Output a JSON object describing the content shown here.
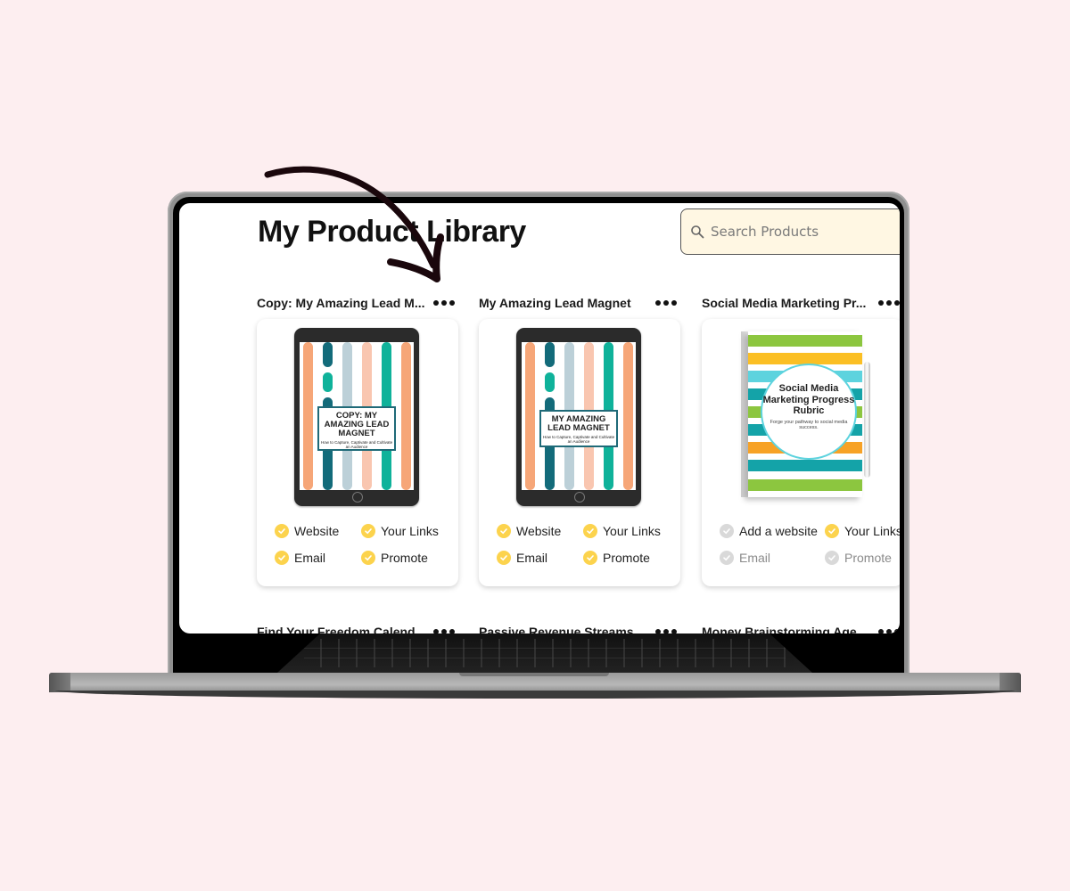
{
  "page": {
    "title": "My Product Library",
    "search": {
      "placeholder": "Search Products",
      "value": "",
      "icon": "search-icon"
    }
  },
  "colors": {
    "background": "#fdeef0",
    "search_bg": "#fff7e3",
    "check_active": "#fcd34d",
    "check_inactive": "#d9d9d9"
  },
  "products": [
    {
      "title": "Copy: My Amazing Lead M...",
      "cover": {
        "type": "tablet",
        "heading": "COPY: MY AMAZING LEAD MAGNET",
        "subheading": "How to Capture, Captivate and Cultivate an Audience"
      },
      "statuses": [
        {
          "label": "Website",
          "done": true
        },
        {
          "label": "Your Links",
          "done": true
        },
        {
          "label": "Email",
          "done": true
        },
        {
          "label": "Promote",
          "done": true
        }
      ],
      "menu_icon": "more-dots-icon"
    },
    {
      "title": "My Amazing Lead Magnet",
      "cover": {
        "type": "tablet",
        "heading": "MY AMAZING LEAD MAGNET",
        "subheading": "How to Capture, Captivate and Cultivate an Audience"
      },
      "statuses": [
        {
          "label": "Website",
          "done": true
        },
        {
          "label": "Your Links",
          "done": true
        },
        {
          "label": "Email",
          "done": true
        },
        {
          "label": "Promote",
          "done": true
        }
      ],
      "menu_icon": "more-dots-icon"
    },
    {
      "title": "Social Media Marketing Pr...",
      "cover": {
        "type": "notebook",
        "heading": "Social Media Marketing Progress Rubric",
        "subheading": "Forge your pathway to social media success."
      },
      "statuses": [
        {
          "label": "Add a website",
          "done": false
        },
        {
          "label": "Your Links",
          "done": true
        },
        {
          "label": "Email",
          "done": false
        },
        {
          "label": "Promote",
          "done": false
        }
      ],
      "menu_icon": "more-dots-icon"
    }
  ],
  "products_row2": [
    {
      "title": "Find Your Freedom Calend..."
    },
    {
      "title": "Passive Revenue Streams"
    },
    {
      "title": "Money Brainstorming Age..."
    }
  ]
}
